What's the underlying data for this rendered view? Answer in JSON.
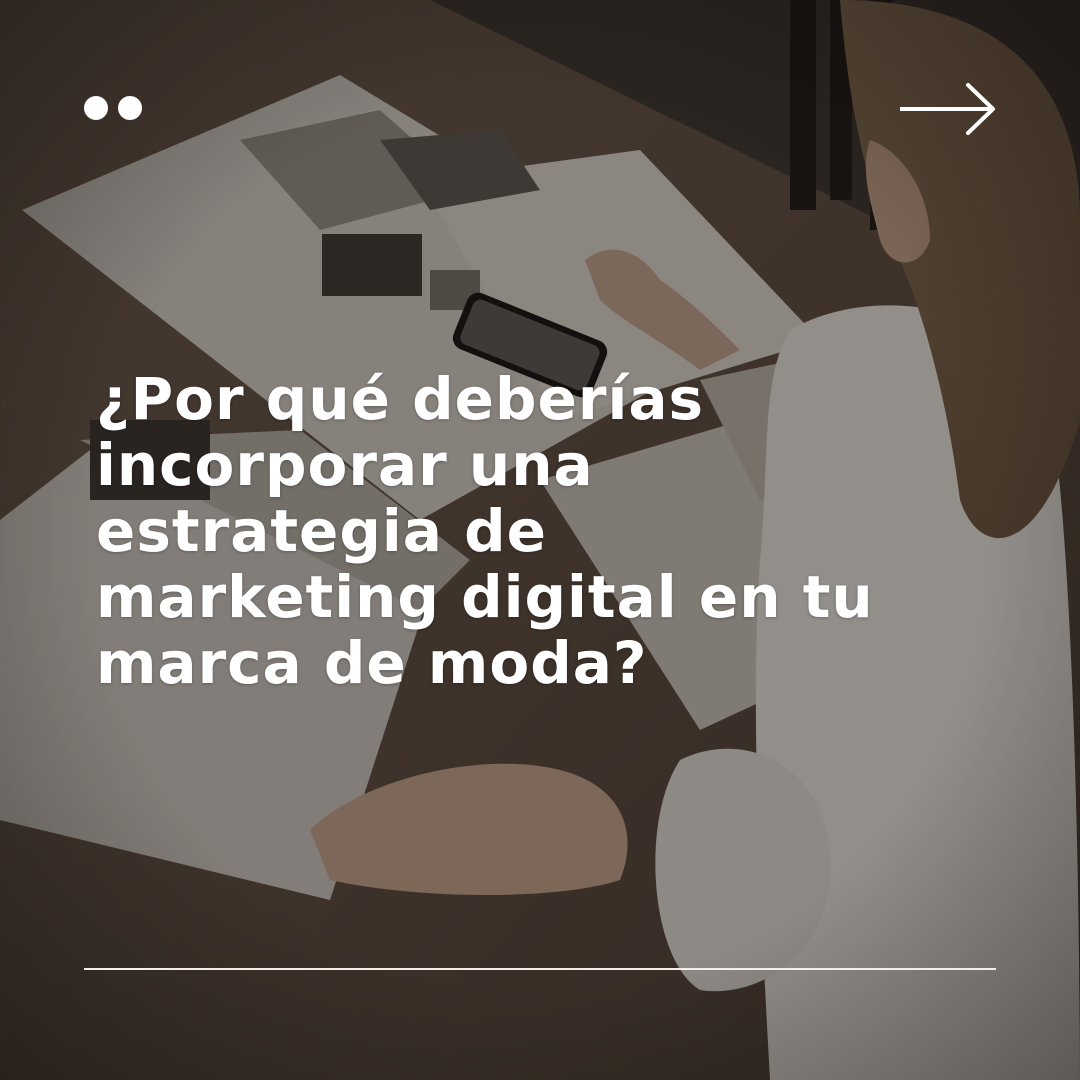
{
  "headline": "¿Por qué deberías\nincorporar una\nestrategia de\nmarketing digital en tu\nmarca de moda?",
  "icons": {
    "pagination": "two-dots-icon",
    "next": "arrow-right-icon"
  },
  "colors": {
    "text": "#ffffff",
    "overlay": "#120f0d",
    "rule": "#f2efea"
  }
}
